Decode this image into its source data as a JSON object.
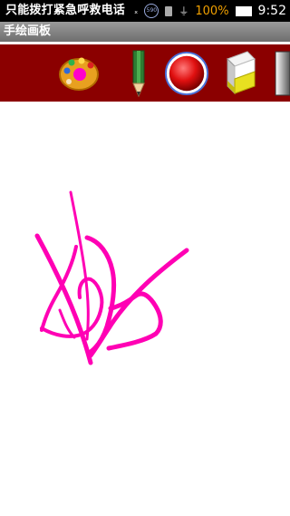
{
  "status_bar": {
    "notification": "只能拨打紧急呼救电话",
    "badge": "590",
    "battery_percent": "100%",
    "time": "9:52"
  },
  "app": {
    "title": "手绘画板"
  },
  "toolbar": {
    "tools": [
      {
        "icon": "palette-icon"
      },
      {
        "icon": "pencil-icon"
      },
      {
        "icon": "brush-size-circle-icon"
      },
      {
        "icon": "eraser-icon"
      },
      {
        "icon": "clear-canvas-icon"
      }
    ],
    "background_color": "#8b0000"
  },
  "canvas": {
    "background_color": "#ffffff",
    "stroke_color": "#ff00b4"
  }
}
